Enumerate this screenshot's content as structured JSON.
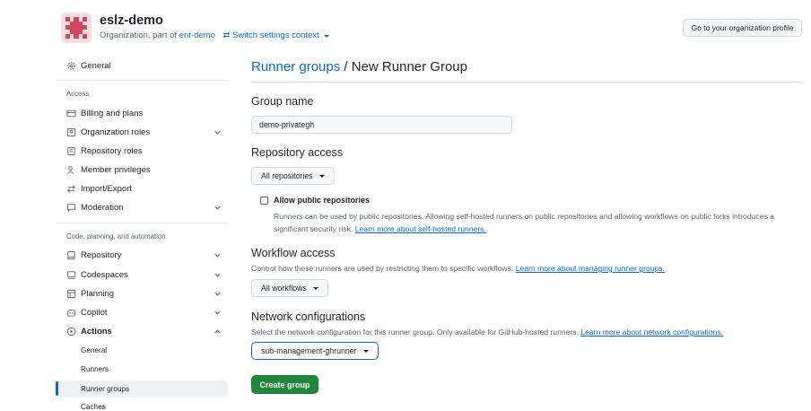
{
  "org": {
    "name": "eslz-demo",
    "subtitle_prefix": "Organization, part of",
    "enterprise": "ent-demo",
    "switch_context": "Switch settings context",
    "profile_button": "Go to your organization profile"
  },
  "sidebar": {
    "general": "General",
    "section_access": "Access",
    "billing": "Billing and plans",
    "org_roles": "Organization roles",
    "repo_roles": "Repository roles",
    "member_privileges": "Member privileges",
    "import_export": "Import/Export",
    "moderation": "Moderation",
    "section_code": "Code, planning, and automation",
    "repository": "Repository",
    "codespaces": "Codespaces",
    "planning": "Planning",
    "copilot": "Copilot",
    "actions": "Actions",
    "actions_sub": [
      "General",
      "Runners",
      "Runner groups",
      "Caches"
    ]
  },
  "main": {
    "breadcrumb_link": "Runner groups",
    "breadcrumb_sep": "/",
    "breadcrumb_current": "New Runner Group",
    "group_name_heading": "Group name",
    "group_name_value": "demo-privategh",
    "repo_access_heading": "Repository access",
    "repo_access_dropdown": "All repositories",
    "allow_public_label": "Allow public repositories",
    "allow_public_desc": "Runners can be used by public repositories. Allowing self-hosted runners on public repositories and allowing workflows on public forks introduces a significant security risk.",
    "allow_public_link": "Learn more about self-hosted runners.",
    "workflow_heading": "Workflow access",
    "workflow_desc": "Control how these runners are used by restricting them to specific workflows.",
    "workflow_link": "Learn more about managing runner groups.",
    "workflow_dropdown": "All workflows",
    "network_heading": "Network configurations",
    "network_desc": "Select the network configuration for this runner group. Only available for GitHub-hosted runners.",
    "network_link": "Learn more about network configurations.",
    "network_dropdown": "sub-management-ghrunner",
    "create_button": "Create group"
  },
  "colors": {
    "link": "#0969da",
    "primary_button": "#1f883d",
    "active_indicator": "#0969da"
  }
}
